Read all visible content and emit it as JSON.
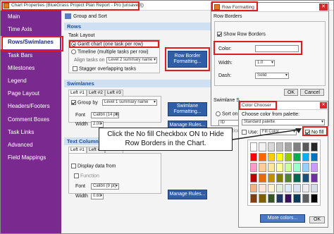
{
  "main_window": {
    "title": "Chart Properties (BlueGrass Project Plan Report - Pro [unsaved])",
    "tab_label": "Group and Sort",
    "sidebar": [
      "Main",
      "Time Axis",
      "Rows/Swimlanes",
      "Task Bars",
      "Milestones",
      "Legend",
      "Page Layout",
      "Headers/Footers",
      "Comment Boxes",
      "Task Links",
      "Advanced",
      "Field Mappings"
    ],
    "rows_header": "Rows",
    "task_layout_label": "Task Layout",
    "gantt_option": "Gantt chart (one task per row)",
    "timeline_option": "Timeline (multiple tasks per row)",
    "align_label": "Align tasks on",
    "align_value": "Level 2 summary name",
    "stagger_label": "Stagger overlapping tasks",
    "row_border_button": "Row Border Formatting...",
    "swimlanes_header": "Swimlanes",
    "sw_tabs": [
      "Left #1",
      "Left #2",
      "Left #3"
    ],
    "group_by_label": "Group by",
    "group_by_value": "Level 1 summary name",
    "font_label": "Font",
    "font_value": "Calibri (14 pt)",
    "width_label": "Width",
    "width_value": "2.00",
    "swimlane_format_button": "Swimlane Formatting...",
    "manage_rules_button": "Manage Rules...",
    "text_columns_header": "Text Columns",
    "tc_tabs": [
      "Left #1",
      "Left #2",
      "Left #3"
    ],
    "display_data_label": "Display data from",
    "function_label": "Function",
    "tc_font_value": "Calibri (9 pt)",
    "tc_width_value": "0.60",
    "tc_manage_rules_button": "Manage Rules..."
  },
  "row_formatting": {
    "title": "Row Formatting",
    "section_label": "Row Borders",
    "show_borders_label": "Show Row Borders",
    "color_label": "Color:",
    "width_label": "Width:",
    "width_value": "1.0",
    "dash_label": "Dash:",
    "dash_value": "Solid",
    "ok_label": "OK",
    "cancel_label": "Cancel",
    "partial_swimlane": "Swimlane S",
    "partial_sort": "Sort on fie",
    "partial_id": "ID",
    "partial_function": "Function"
  },
  "color_chooser": {
    "title": "Color Chooser",
    "palette_prompt": "Choose color from palette:",
    "palette_value": "Standard palette",
    "use_label": "Use:",
    "use_value": "Fill Color",
    "no_fill_label": "No fill",
    "more_colors_label": "More colors...",
    "ok_label": "OK",
    "swatches": [
      "#ffffff",
      "#f2f2f2",
      "#d9d9d9",
      "#bfbfbf",
      "#a6a6a6",
      "#808080",
      "#595959",
      "#262626",
      "#ff0000",
      "#ff6600",
      "#ffcc00",
      "#ffff00",
      "#99cc00",
      "#00b050",
      "#00b0f0",
      "#0070c0",
      "#ff99cc",
      "#ffcc99",
      "#ffe699",
      "#ffff99",
      "#ccff99",
      "#99ffcc",
      "#99ccff",
      "#cc99ff",
      "#c00000",
      "#e46c0a",
      "#bf9000",
      "#7f7f00",
      "#548235",
      "#00664d",
      "#1f4e79",
      "#7030a0",
      "#f4b183",
      "#fbe5d6",
      "#fff2cc",
      "#e2f0d9",
      "#deebf7",
      "#dae3f3",
      "#ededed",
      "#d6dce5",
      "#843c0c",
      "#7f6000",
      "#375623",
      "#203864",
      "#3a0f5a",
      "#0c3c5c",
      "#5f5f5f",
      "#000000"
    ]
  },
  "callout": {
    "text": "Click the No fill Checkbox ON to Hide Row Borders in the Chart."
  },
  "colors": {
    "sidebar": "#7a2a8f",
    "accent_blue": "#2f5da6",
    "highlight_red": "#e01b1b"
  }
}
